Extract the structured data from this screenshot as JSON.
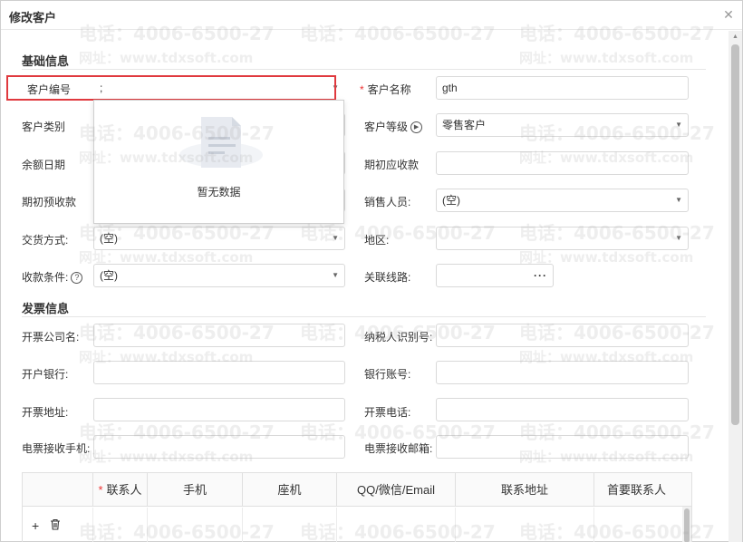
{
  "dialog": {
    "title": "修改客户",
    "close_icon": "close-icon"
  },
  "watermark": {
    "phone": "电话：4006-6500-27",
    "site": "网址：www.tdxsoft.com"
  },
  "sections": {
    "basic": "基础信息",
    "invoice": "发票信息"
  },
  "basic": {
    "customer_code": {
      "label": "客户编号",
      "value": ";"
    },
    "customer_name": {
      "label": "客户名称",
      "value": "gth",
      "required": "*"
    },
    "customer_type": {
      "label": "客户类别"
    },
    "customer_level": {
      "label": "客户等级",
      "value": "零售客户"
    },
    "balance_date": {
      "label": "余额日期"
    },
    "opening_receivable": {
      "label": "期初应收款"
    },
    "opening_prepaid": {
      "label": "期初预收款"
    },
    "salesperson": {
      "label": "销售人员:",
      "value": "(空)"
    },
    "delivery_method": {
      "label": "交货方式:",
      "value": "(空)"
    },
    "region": {
      "label": "地区:"
    },
    "payment_terms": {
      "label": "收款条件:",
      "value": "(空)"
    },
    "route": {
      "label": "关联线路:",
      "button": "···"
    }
  },
  "invoice": {
    "company_name": {
      "label": "开票公司名:"
    },
    "tax_id": {
      "label": "纳税人识别号:"
    },
    "bank": {
      "label": "开户银行:"
    },
    "bank_account": {
      "label": "银行账号:"
    },
    "address": {
      "label": "开票地址:"
    },
    "phone": {
      "label": "开票电话:"
    },
    "e_invoice_mobile": {
      "label": "电票接收手机:"
    },
    "e_invoice_email": {
      "label": "电票接收邮箱:"
    }
  },
  "dropdown": {
    "empty_text": "暂无数据"
  },
  "contacts_table": {
    "columns": [
      "联系人",
      "手机",
      "座机",
      "QQ/微信/Email",
      "联系地址",
      "首要联系人"
    ],
    "required_mark": "*",
    "add_label": "+",
    "delete_icon": "trash-icon"
  }
}
